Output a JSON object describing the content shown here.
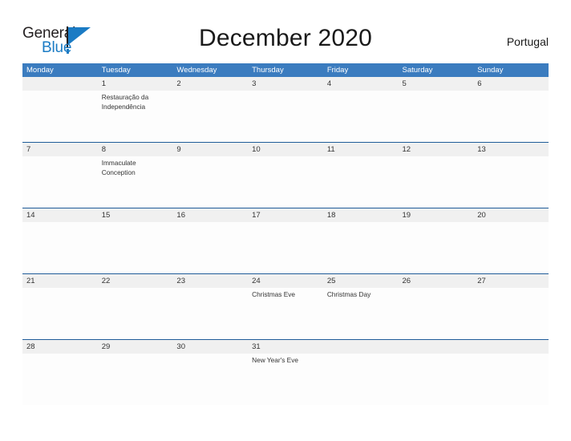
{
  "brand": {
    "name_part1": "General",
    "name_part2": "Blue",
    "flag_icon": "flag-triangle-icon",
    "accent_color": "#1a7bc4"
  },
  "header": {
    "title": "December 2020",
    "country": "Portugal"
  },
  "theme": {
    "header_blue": "#3b7cbf",
    "row_border_blue": "#1f5c99",
    "date_band_gray": "#f0f0f0",
    "text_dark": "#333333"
  },
  "calendar": {
    "weekdays": [
      "Monday",
      "Tuesday",
      "Wednesday",
      "Thursday",
      "Friday",
      "Saturday",
      "Sunday"
    ],
    "weeks": [
      {
        "days": [
          {
            "date": "",
            "event": ""
          },
          {
            "date": "1",
            "event": "Restauração da Independência"
          },
          {
            "date": "2",
            "event": ""
          },
          {
            "date": "3",
            "event": ""
          },
          {
            "date": "4",
            "event": ""
          },
          {
            "date": "5",
            "event": ""
          },
          {
            "date": "6",
            "event": ""
          }
        ]
      },
      {
        "days": [
          {
            "date": "7",
            "event": ""
          },
          {
            "date": "8",
            "event": "Immaculate Conception"
          },
          {
            "date": "9",
            "event": ""
          },
          {
            "date": "10",
            "event": ""
          },
          {
            "date": "11",
            "event": ""
          },
          {
            "date": "12",
            "event": ""
          },
          {
            "date": "13",
            "event": ""
          }
        ]
      },
      {
        "days": [
          {
            "date": "14",
            "event": ""
          },
          {
            "date": "15",
            "event": ""
          },
          {
            "date": "16",
            "event": ""
          },
          {
            "date": "17",
            "event": ""
          },
          {
            "date": "18",
            "event": ""
          },
          {
            "date": "19",
            "event": ""
          },
          {
            "date": "20",
            "event": ""
          }
        ]
      },
      {
        "days": [
          {
            "date": "21",
            "event": ""
          },
          {
            "date": "22",
            "event": ""
          },
          {
            "date": "23",
            "event": ""
          },
          {
            "date": "24",
            "event": "Christmas Eve"
          },
          {
            "date": "25",
            "event": "Christmas Day"
          },
          {
            "date": "26",
            "event": ""
          },
          {
            "date": "27",
            "event": ""
          }
        ]
      },
      {
        "days": [
          {
            "date": "28",
            "event": ""
          },
          {
            "date": "29",
            "event": ""
          },
          {
            "date": "30",
            "event": ""
          },
          {
            "date": "31",
            "event": "New Year's Eve"
          },
          {
            "date": "",
            "event": ""
          },
          {
            "date": "",
            "event": ""
          },
          {
            "date": "",
            "event": ""
          }
        ]
      }
    ]
  }
}
